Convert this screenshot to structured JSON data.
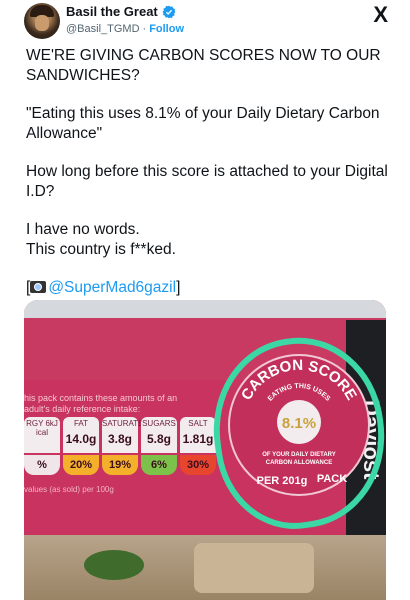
{
  "user": {
    "display_name": "Basil the Great",
    "handle": "@Basil_TGMD",
    "follow_label": "Follow",
    "separator": "·"
  },
  "platform_logo": "X",
  "tweet": {
    "line1": "WE'RE GIVING CARBON SCORES NOW TO OUR SANDWICHES?",
    "line2": "\"Eating this uses 8.1% of your Daily Dietary Carbon Allowance\"",
    "line3": "How long before this score is attached to your Digital I.D?",
    "line4a": "I have no words.",
    "line4b": "This country is f**ked.",
    "credit_open": "[",
    "credit_mention": "@SuperMad6gazil",
    "credit_close": "]"
  },
  "media": {
    "intake_text": "his pack contains these amounts of an adult's daily reference intake:",
    "nutrients": [
      {
        "label": "RGY 6kJ ical",
        "value": ""
      },
      {
        "label": "FAT",
        "value": "14.0g"
      },
      {
        "label": "SATURATES",
        "value": "3.8g"
      },
      {
        "label": "SUGARS",
        "value": "5.8g"
      },
      {
        "label": "SALT",
        "value": "1.81g"
      }
    ],
    "percents": [
      "%",
      "20%",
      "19%",
      "6%",
      "30%"
    ],
    "values_note": "values (as sold) per 100g",
    "seal": {
      "top_text": "CARBON SCORE",
      "sub_text": "EATING THIS USES",
      "value": "8.1%",
      "allowance1": "OF YOUR DAILY DIETARY",
      "allowance2": "CARBON ALLOWANCE",
      "bottom_text": "PER 201g",
      "bottom_text2": "PACK"
    },
    "brand_fragment": "Daviost",
    "colors": {
      "pack": "#c8335f",
      "highlight": "#3bd8a6",
      "verified": "#1d9bf0"
    }
  }
}
